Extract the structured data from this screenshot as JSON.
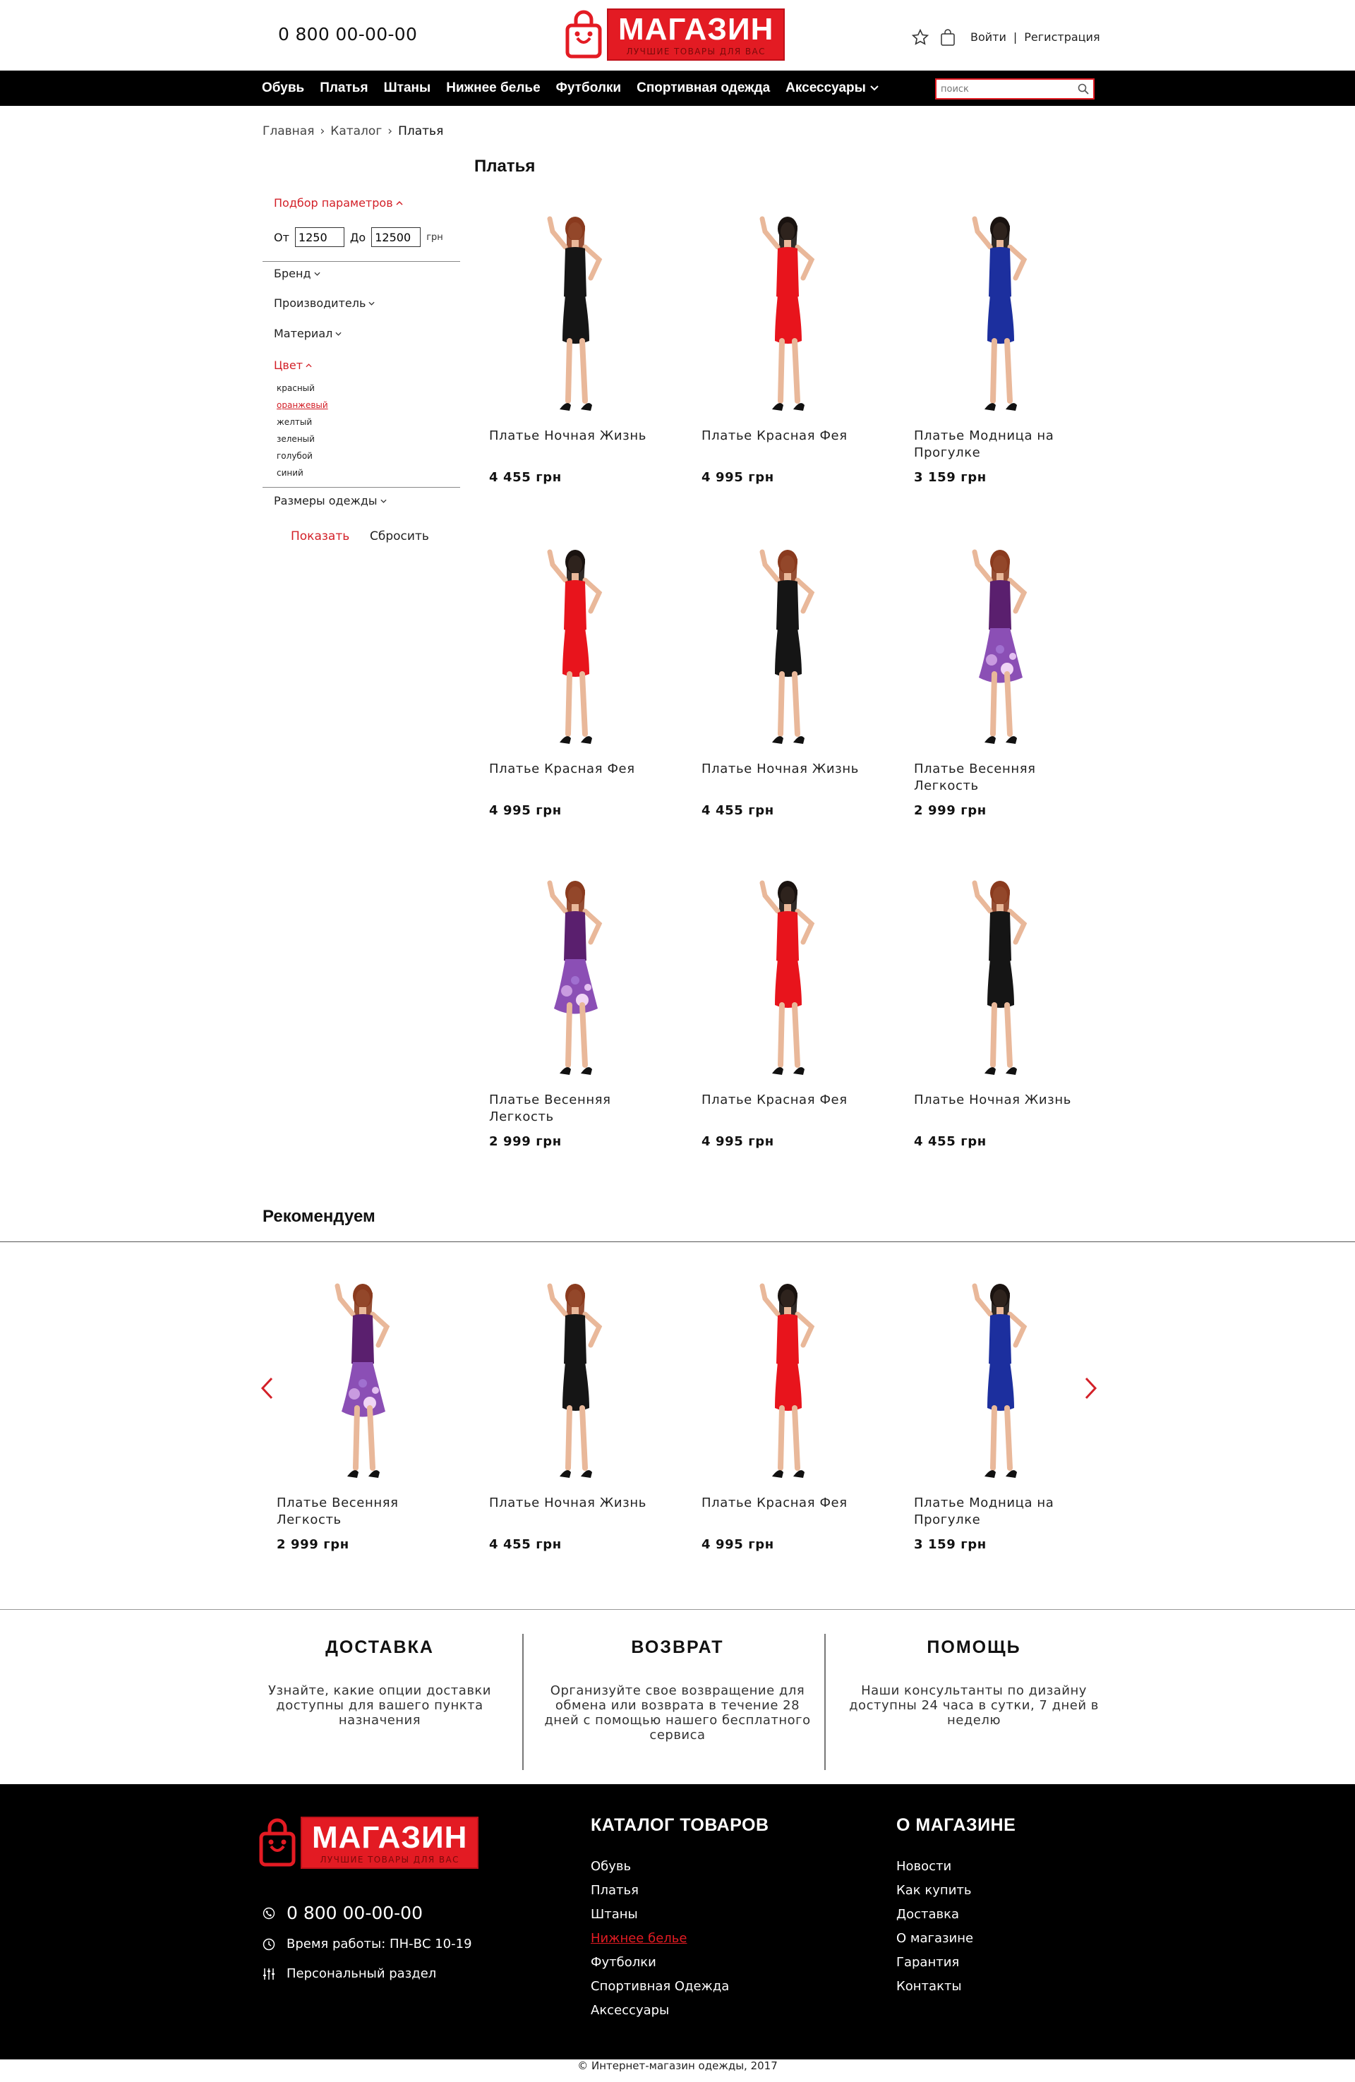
{
  "header": {
    "phone": "0 800 00-00-00",
    "logo_name": "МАГАЗИН",
    "logo_tagline": "ЛУЧШИЕ ТОВАРЫ ДЛЯ ВАС",
    "login": "Войти",
    "separator": "|",
    "register": "Регистрация"
  },
  "nav": {
    "items": [
      "Обувь",
      "Платья",
      "Штаны",
      "Нижнее белье",
      "Футболки",
      "Спортивная одежда",
      "Аксессуары"
    ],
    "search_placeholder": "поиск"
  },
  "breadcrumb": [
    "Главная",
    "›",
    "Каталог",
    "›",
    "Платья"
  ],
  "page_title": "Платья",
  "filters": {
    "params_label": "Подбор параметров",
    "from_label": "От",
    "from_value": "1250",
    "to_label": "До",
    "to_value": "12500",
    "currency": "грн",
    "brand": "Бренд",
    "manufacturer": "Производитель",
    "material": "Материал",
    "color": "Цвет",
    "colors": [
      "красный",
      "оранжевый",
      "желтый",
      "зеленый",
      "голубой",
      "синий"
    ],
    "sizes": "Размеры одежды",
    "show": "Показать",
    "reset": "Сбросить"
  },
  "products": [
    {
      "name": "Платье Ночная Жизнь",
      "price": "4 455 грн",
      "dress": "black"
    },
    {
      "name": "Платье Красная Фея",
      "price": "4 995 грн",
      "dress": "red"
    },
    {
      "name": "Платье Модница на Прогулке",
      "price": "3 159 грн",
      "dress": "blue"
    },
    {
      "name": "Платье Красная Фея",
      "price": "4 995 грн",
      "dress": "red"
    },
    {
      "name": "Платье Ночная Жизнь",
      "price": "4 455 грн",
      "dress": "black"
    },
    {
      "name": "Платье Весенняя Легкость",
      "price": "2 999 грн",
      "dress": "purple"
    },
    {
      "name": "Платье Весенняя Легкость",
      "price": "2 999 грн",
      "dress": "purple"
    },
    {
      "name": "Платье Красная Фея",
      "price": "4 995 грн",
      "dress": "red"
    },
    {
      "name": "Платье Ночная Жизнь",
      "price": "4 455 грн",
      "dress": "black"
    }
  ],
  "recommend": {
    "title": "Рекомендуем",
    "items": [
      {
        "name": "Платье Весенняя Легкость",
        "price": "2 999 грн",
        "dress": "purple"
      },
      {
        "name": "Платье Ночная Жизнь",
        "price": "4 455 грн",
        "dress": "black"
      },
      {
        "name": "Платье Красная Фея",
        "price": "4 995 грн",
        "dress": "red"
      },
      {
        "name": "Платье Модница на Прогулке",
        "price": "3 159 грн",
        "dress": "blue"
      }
    ]
  },
  "info": [
    {
      "title": "ДОСТАВКА",
      "text": "Узнайте, какие опции доставки доступны для вашего пункта назначения"
    },
    {
      "title": "ВОЗВРАТ",
      "text": "Организуйте свое возвращение для обмена или возврата в течение 28 дней с помощью нашего бесплатного сервиса"
    },
    {
      "title": "ПОМОЩЬ",
      "text": "Наши консультанты по дизайну доступны 24 часа в сутки, 7 дней в неделю"
    }
  ],
  "footer": {
    "logo_name": "МАГАЗИН",
    "logo_tagline": "ЛУЧШИЕ ТОВАРЫ ДЛЯ ВАС",
    "phone": "0 800 00-00-00",
    "hours": "Время работы: ПН-ВС 10-19",
    "personal": "Персональный раздел",
    "catalog_title": "КАТАЛОГ ТОВАРОВ",
    "catalog": [
      "Обувь",
      "Платья",
      "Штаны",
      "Нижнее белье",
      "Футболки",
      "Спортивная Одежда",
      "Аксессуары"
    ],
    "about_title": "О МАГАЗИНЕ",
    "about": [
      "Новости",
      "Как купить",
      "Доставка",
      "О магазине",
      "Гарантия",
      "Контакты"
    ],
    "copyright": "© Интернет-магазин одежды, 2017"
  },
  "colors": {
    "accent": "#e31b23",
    "black_dress": "#151515",
    "red_dress": "#e8141c",
    "blue_dress": "#1c2f9e",
    "purple_dress": "#5a1f6e"
  }
}
